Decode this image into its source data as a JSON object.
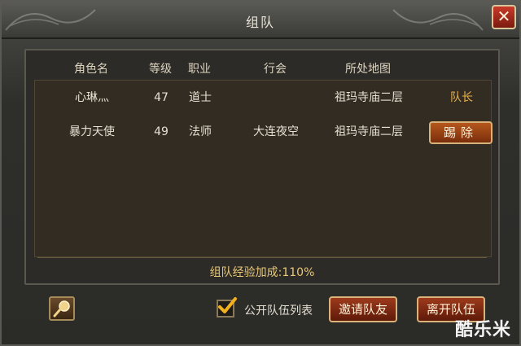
{
  "window": {
    "title": "组队",
    "close_icon": "close-icon"
  },
  "table": {
    "headers": [
      "角色名",
      "等级",
      "职业",
      "行会",
      "所处地图"
    ],
    "rows": [
      {
        "name": "心琳灬",
        "level": "47",
        "class": "道士",
        "guild": "",
        "map": "祖玛寺庙二层",
        "role": "队长"
      },
      {
        "name": "暴力天使",
        "level": "49",
        "class": "法师",
        "guild": "大连夜空",
        "map": "祖玛寺庙二层",
        "action": "踢除"
      }
    ]
  },
  "bonus_text": "组队经验加成:110%",
  "footer": {
    "public_list_label": "公开队伍列表",
    "public_list_checked": true,
    "invite_label": "邀请队友",
    "leave_label": "离开队伍"
  },
  "watermark": "酷乐米",
  "colors": {
    "accent_gold": "#e8b24a",
    "button_red": "#9d3a1c",
    "close_red": "#c83a2a"
  }
}
